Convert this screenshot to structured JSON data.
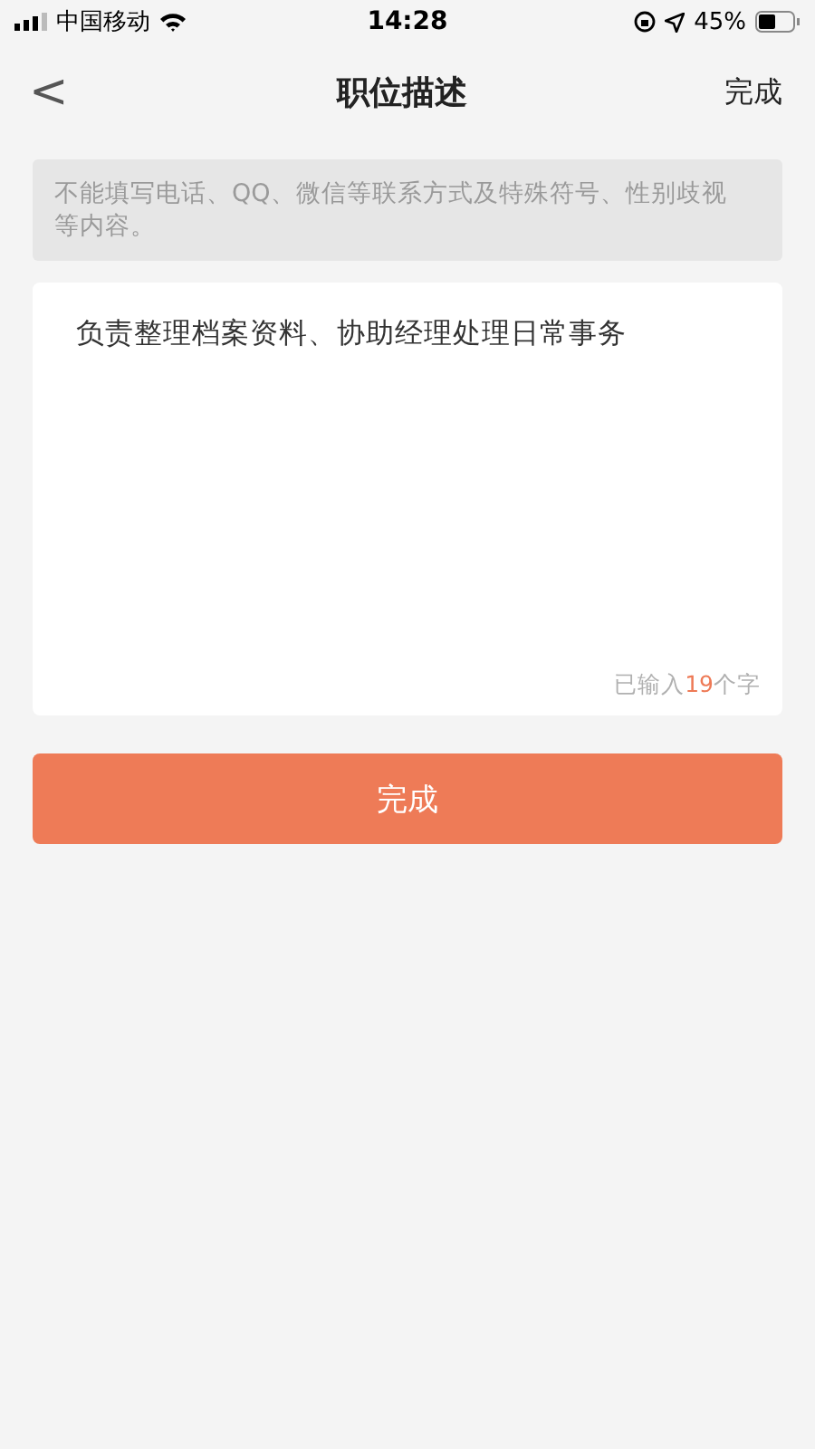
{
  "status_bar": {
    "carrier": "中国移动",
    "time": "14:28",
    "battery": "45%"
  },
  "nav": {
    "back": "<",
    "title": "职位描述",
    "action": "完成"
  },
  "notice": "不能填写电话、QQ、微信等联系方式及特殊符号、性别歧视等内容。",
  "description": {
    "value": "负责整理档案资料、协助经理处理日常事务",
    "counter": {
      "prefix": "已输入",
      "count": "19",
      "suffix": "个字"
    }
  },
  "submit": "完成"
}
